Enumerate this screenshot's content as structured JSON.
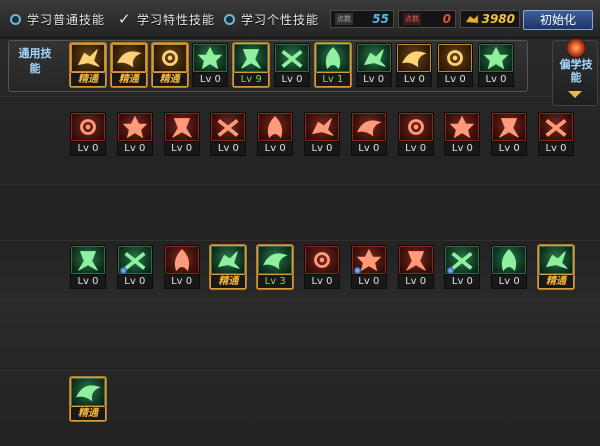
{
  "tabs": [
    {
      "label": "学习普通技能",
      "control": "radio"
    },
    {
      "label": "学习特性技能",
      "control": "check"
    },
    {
      "label": "学习个性技能",
      "control": "radio"
    }
  ],
  "stats": {
    "blue": {
      "tag": "点数",
      "value": "55",
      "color": "#4fb8f0"
    },
    "red": {
      "tag": "点数",
      "value": "0",
      "color": "#e6512a"
    },
    "gold": {
      "value": "3980",
      "color": "#f2c23a"
    }
  },
  "init_button": "初始化",
  "common_label": "通用技能",
  "side_label": "偏学技能",
  "common_skills": [
    {
      "icon": "seated-figure-icon",
      "level": "精通",
      "tone": "gold",
      "style": "master"
    },
    {
      "icon": "runner-icon",
      "level": "精通",
      "tone": "gold",
      "style": "master"
    },
    {
      "icon": "sprint-icon",
      "level": "精通",
      "tone": "gold",
      "style": "master"
    },
    {
      "icon": "wings-icon",
      "level": "Lv 0",
      "tone": "green",
      "style": "normal"
    },
    {
      "icon": "crosshair-icon",
      "level": "Lv 9",
      "tone": "green",
      "style": "active"
    },
    {
      "icon": "target-icon",
      "level": "Lv 0",
      "tone": "green",
      "style": "normal"
    },
    {
      "icon": "warrior-icon",
      "level": "Lv 1",
      "tone": "green",
      "style": "active"
    },
    {
      "icon": "helmet-icon",
      "level": "Lv 0",
      "tone": "green",
      "style": "normal"
    },
    {
      "icon": "spiral-icon",
      "level": "Lv 0",
      "tone": "gold",
      "style": "normal"
    },
    {
      "icon": "muscle-icon",
      "level": "Lv 0",
      "tone": "gold",
      "style": "normal"
    },
    {
      "icon": "kick-icon",
      "level": "Lv 0",
      "tone": "green",
      "style": "normal"
    }
  ],
  "skill_row_1": [
    {
      "icon": "dash-strike-icon",
      "level": "Lv 0",
      "tone": "red",
      "style": "normal"
    },
    {
      "icon": "slash-icon",
      "level": "Lv 0",
      "tone": "red",
      "style": "normal"
    },
    {
      "icon": "wind-icon",
      "level": "Lv 0",
      "tone": "red",
      "style": "normal"
    },
    {
      "icon": "claw-icon",
      "level": "Lv 0",
      "tone": "red",
      "style": "normal"
    },
    {
      "icon": "fist-icon",
      "level": "Lv 0",
      "tone": "red",
      "style": "normal"
    },
    {
      "icon": "leap-icon",
      "level": "Lv 0",
      "tone": "red",
      "style": "normal"
    },
    {
      "icon": "ankh-icon",
      "level": "Lv 0",
      "tone": "red",
      "style": "normal"
    },
    {
      "icon": "rune-icon",
      "level": "Lv 0",
      "tone": "red",
      "style": "normal"
    },
    {
      "icon": "cross-icon",
      "level": "Lv 0",
      "tone": "red",
      "style": "normal"
    },
    {
      "icon": "bird-icon",
      "level": "Lv 0",
      "tone": "red",
      "style": "normal"
    },
    {
      "icon": "shadow-icon",
      "level": "Lv 0",
      "tone": "red",
      "style": "normal"
    }
  ],
  "skill_row_2": [
    {
      "icon": "arrow-right-icon",
      "level": "Lv 0",
      "tone": "green",
      "style": "normal",
      "pip": false
    },
    {
      "icon": "spin-icon",
      "level": "Lv 0",
      "tone": "green",
      "style": "normal",
      "pip": true
    },
    {
      "icon": "flame-leap-icon",
      "level": "Lv 0",
      "tone": "red",
      "style": "normal",
      "pip": false
    },
    {
      "icon": "holy-cross-icon",
      "level": "精通",
      "tone": "green",
      "style": "master",
      "pip": false
    },
    {
      "icon": "vortex-icon",
      "level": "Lv 3",
      "tone": "green",
      "style": "active",
      "pip": false
    },
    {
      "icon": "dragon-icon",
      "level": "Lv 0",
      "tone": "red",
      "style": "normal",
      "pip": false
    },
    {
      "icon": "cross-blades-icon",
      "level": "Lv 0",
      "tone": "red",
      "style": "normal",
      "pip": true
    },
    {
      "icon": "fire-icon",
      "level": "Lv 0",
      "tone": "red",
      "style": "normal",
      "pip": false
    },
    {
      "icon": "beast-icon",
      "level": "Lv 0",
      "tone": "green",
      "style": "normal",
      "pip": true
    },
    {
      "icon": "wing-strike-icon",
      "level": "Lv 0",
      "tone": "green",
      "style": "normal",
      "pip": false
    },
    {
      "icon": "beast-head-icon",
      "level": "精通",
      "tone": "green",
      "style": "master",
      "pip": false
    }
  ],
  "skill_row_3": [
    {
      "icon": "berserk-icon",
      "level": "精通",
      "tone": "green",
      "style": "master",
      "pip": false
    }
  ]
}
